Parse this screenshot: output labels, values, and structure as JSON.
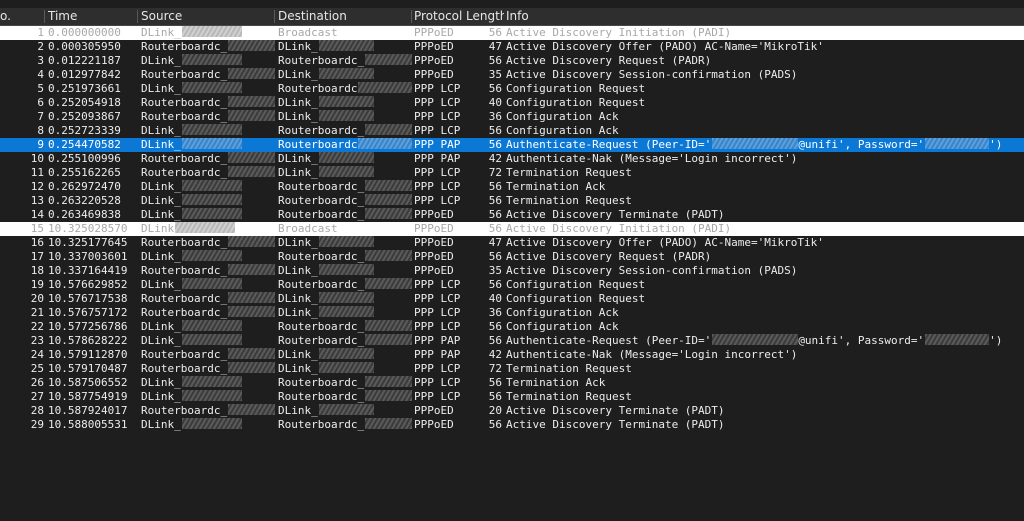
{
  "columns": {
    "no": "o.",
    "time": "Time",
    "source": "Source",
    "destination": "Destination",
    "protocol": "Protocol",
    "length": "Length",
    "info": "Info"
  },
  "colors": {
    "background": "#1e1e1e",
    "selected_row": "#0c78d6",
    "broadcast_row": "#ffffff"
  },
  "redacted_icon": "blurred-redaction",
  "packets": [
    {
      "no": "1",
      "time": "0.000000000",
      "src": "DLink_",
      "dst": "Broadcast",
      "proto": "PPPoED",
      "len": "56",
      "info": "Active Discovery Initiation (PADI)",
      "style": "light"
    },
    {
      "no": "2",
      "time": "0.000305950",
      "src": "Routerboardc_",
      "dst": "DLink_",
      "proto": "PPPoED",
      "len": "47",
      "info": "Active Discovery Offer (PADO) AC-Name='MikroTik'",
      "style": "dark"
    },
    {
      "no": "3",
      "time": "0.012221187",
      "src": "DLink_",
      "dst": "Routerboardc_",
      "proto": "PPPoED",
      "len": "56",
      "info": "Active Discovery Request (PADR)",
      "style": "dark"
    },
    {
      "no": "4",
      "time": "0.012977842",
      "src": "Routerboardc_",
      "dst": "DLink_",
      "proto": "PPPoED",
      "len": "35",
      "info": "Active Discovery Session-confirmation (PADS)",
      "style": "dark"
    },
    {
      "no": "5",
      "time": "0.251973661",
      "src": "DLink_",
      "dst": "Routerboardc",
      "proto": "PPP LCP",
      "len": "56",
      "info": "Configuration Request",
      "style": "dark"
    },
    {
      "no": "6",
      "time": "0.252054918",
      "src": "Routerboardc_",
      "dst": "DLink_",
      "proto": "PPP LCP",
      "len": "40",
      "info": "Configuration Request",
      "style": "dark"
    },
    {
      "no": "7",
      "time": "0.252093867",
      "src": "Routerboardc_",
      "dst": "DLink_",
      "proto": "PPP LCP",
      "len": "36",
      "info": "Configuration Ack",
      "style": "dark"
    },
    {
      "no": "8",
      "time": "0.252723339",
      "src": "DLink_",
      "dst": "Routerboardc_",
      "proto": "PPP LCP",
      "len": "56",
      "info": "Configuration Ack",
      "style": "dark"
    },
    {
      "no": "9",
      "time": "0.254470582",
      "src": "DLink_",
      "dst": "Routerboardc",
      "proto": "PPP PAP",
      "len": "56",
      "info": "Authenticate-Request (Peer-ID='",
      "info_mid": "@unifi', Password='",
      "info_end": "')",
      "style": "sel"
    },
    {
      "no": "10",
      "time": "0.255100996",
      "src": "Routerboardc_",
      "dst": "DLink_",
      "proto": "PPP PAP",
      "len": "42",
      "info": "Authenticate-Nak (Message='Login incorrect')",
      "style": "dark"
    },
    {
      "no": "11",
      "time": "0.255162265",
      "src": "Routerboardc_",
      "dst": "DLink_",
      "proto": "PPP LCP",
      "len": "72",
      "info": "Termination Request",
      "style": "dark"
    },
    {
      "no": "12",
      "time": "0.262972470",
      "src": "DLink_",
      "dst": "Routerboardc_",
      "proto": "PPP LCP",
      "len": "56",
      "info": "Termination Ack",
      "style": "dark"
    },
    {
      "no": "13",
      "time": "0.263220528",
      "src": "DLink_",
      "dst": "Routerboardc_",
      "proto": "PPP LCP",
      "len": "56",
      "info": "Termination Request",
      "style": "dark"
    },
    {
      "no": "14",
      "time": "0.263469838",
      "src": "DLink_",
      "dst": "Routerboardc_",
      "proto": "PPPoED",
      "len": "56",
      "info": "Active Discovery Terminate (PADT)",
      "style": "dark"
    },
    {
      "no": "15",
      "time": "10.325028570",
      "src": "DLink",
      "dst": "Broadcast",
      "proto": "PPPoED",
      "len": "56",
      "info": "Active Discovery Initiation (PADI)",
      "style": "light"
    },
    {
      "no": "16",
      "time": "10.325177645",
      "src": "Routerboardc_",
      "dst": "DLink_",
      "proto": "PPPoED",
      "len": "47",
      "info": "Active Discovery Offer (PADO) AC-Name='MikroTik'",
      "style": "dark"
    },
    {
      "no": "17",
      "time": "10.337003601",
      "src": "DLink_",
      "dst": "Routerboardc_",
      "proto": "PPPoED",
      "len": "56",
      "info": "Active Discovery Request (PADR)",
      "style": "dark"
    },
    {
      "no": "18",
      "time": "10.337164419",
      "src": "Routerboardc_",
      "dst": "DLink_",
      "proto": "PPPoED",
      "len": "35",
      "info": "Active Discovery Session-confirmation (PADS)",
      "style": "dark"
    },
    {
      "no": "19",
      "time": "10.576629852",
      "src": "DLink_",
      "dst": "Routerboardc_",
      "proto": "PPP LCP",
      "len": "56",
      "info": "Configuration Request",
      "style": "dark"
    },
    {
      "no": "20",
      "time": "10.576717538",
      "src": "Routerboardc_",
      "dst": "DLink_",
      "proto": "PPP LCP",
      "len": "40",
      "info": "Configuration Request",
      "style": "dark"
    },
    {
      "no": "21",
      "time": "10.576757172",
      "src": "Routerboardc_",
      "dst": "DLink_",
      "proto": "PPP LCP",
      "len": "36",
      "info": "Configuration Ack",
      "style": "dark"
    },
    {
      "no": "22",
      "time": "10.577256786",
      "src": "DLink_",
      "dst": "Routerboardc_",
      "proto": "PPP LCP",
      "len": "56",
      "info": "Configuration Ack",
      "style": "dark"
    },
    {
      "no": "23",
      "time": "10.578628222",
      "src": "DLink_",
      "dst": "Routerboardc_",
      "proto": "PPP PAP",
      "len": "56",
      "info": "Authenticate-Request (Peer-ID='",
      "info_mid": "@unifi', Password='",
      "info_end": "')",
      "style": "dark"
    },
    {
      "no": "24",
      "time": "10.579112870",
      "src": "Routerboardc_",
      "dst": "DLink_",
      "proto": "PPP PAP",
      "len": "42",
      "info": "Authenticate-Nak (Message='Login incorrect')",
      "style": "dark"
    },
    {
      "no": "25",
      "time": "10.579170487",
      "src": "Routerboardc_",
      "dst": "DLink_",
      "proto": "PPP LCP",
      "len": "72",
      "info": "Termination Request",
      "style": "dark"
    },
    {
      "no": "26",
      "time": "10.587506552",
      "src": "DLink_",
      "dst": "Routerboardc_",
      "proto": "PPP LCP",
      "len": "56",
      "info": "Termination Ack",
      "style": "dark"
    },
    {
      "no": "27",
      "time": "10.587754919",
      "src": "DLink_",
      "dst": "Routerboardc_",
      "proto": "PPP LCP",
      "len": "56",
      "info": "Termination Request",
      "style": "dark"
    },
    {
      "no": "28",
      "time": "10.587924017",
      "src": "Routerboardc_",
      "dst": "DLink_",
      "proto": "PPPoED",
      "len": "20",
      "info": "Active Discovery Terminate (PADT)",
      "style": "dark"
    },
    {
      "no": "29",
      "time": "10.588005531",
      "src": "DLink_",
      "dst": "Routerboardc_",
      "proto": "PPPoED",
      "len": "56",
      "info": "Active Discovery Terminate (PADT)",
      "style": "dark"
    }
  ]
}
